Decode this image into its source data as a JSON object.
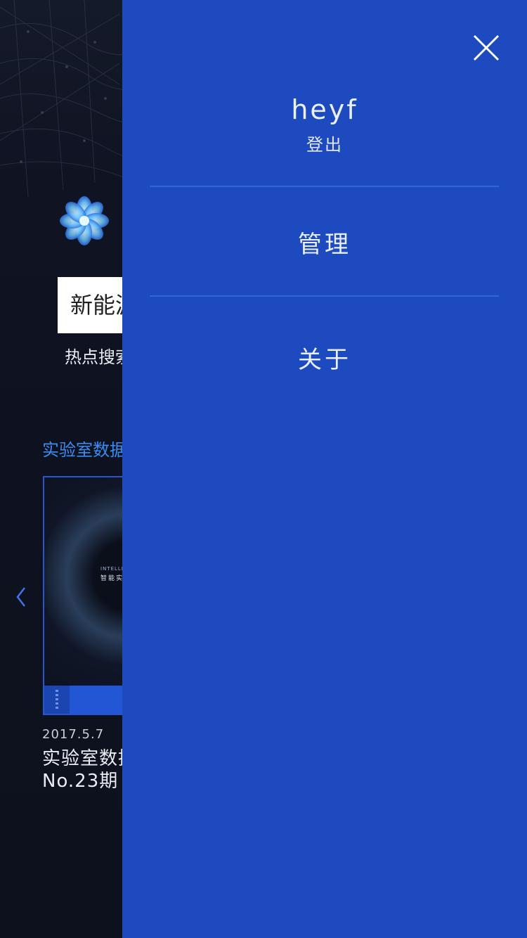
{
  "background": {
    "logo_icon": "flower-logo-icon",
    "search_value": "新能源",
    "hot_search_label": "热点搜索",
    "section_title": "实验室数据",
    "prev_arrow_icon": "chevron-left-icon",
    "card": {
      "cover_subtitle": "INTELLIG",
      "cover_title": "智能实",
      "date": "2017.5.7",
      "title": "实验室数据",
      "issue": "No.23期"
    }
  },
  "drawer": {
    "close_icon": "close-icon",
    "username": "heyf",
    "logout_label": "登出",
    "menu": [
      {
        "label": "管理"
      },
      {
        "label": "关于"
      }
    ]
  },
  "colors": {
    "drawer_bg": "#1d4bbf",
    "divider": "#3465d6",
    "accent": "#3a8cf2",
    "page_bg": "#0e1220",
    "card_bar": "#2256d4"
  }
}
